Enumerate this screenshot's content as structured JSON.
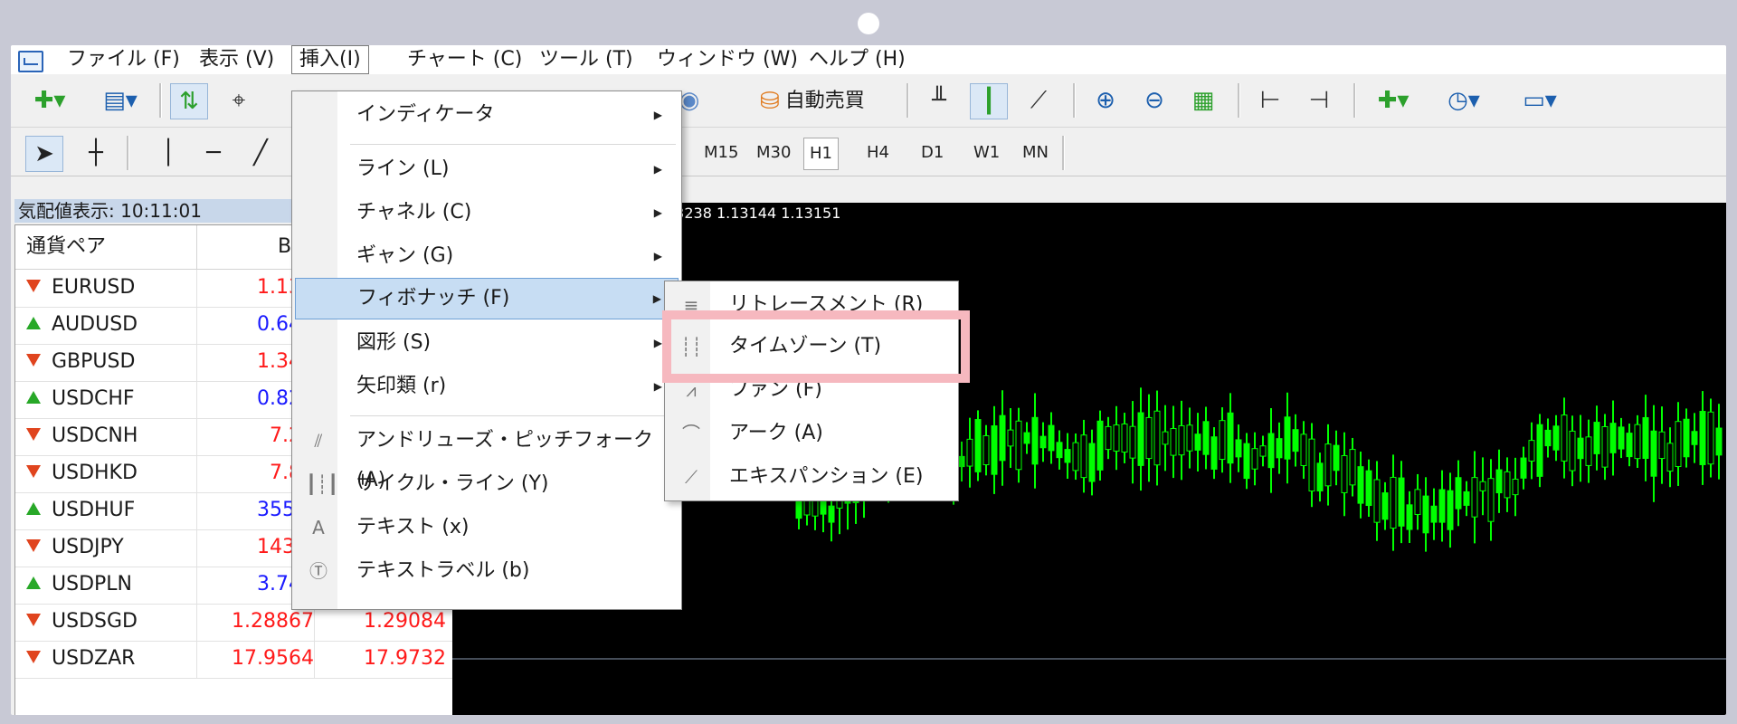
{
  "menubar": {
    "items": [
      {
        "label": "ファイル (F)"
      },
      {
        "label": "表示 (V)"
      },
      {
        "label": "挿入(I)"
      },
      {
        "label": "チャート (C)"
      },
      {
        "label": "ツール (T)"
      },
      {
        "label": "ウィンドウ (W)"
      },
      {
        "label": "ヘルプ (H)"
      }
    ]
  },
  "toolbar": {
    "autotrade_label": "自動売買"
  },
  "timeframes": [
    "M15",
    "M30",
    "H1",
    "H4",
    "D1",
    "W1",
    "MN"
  ],
  "selected_timeframe": "H1",
  "market_watch": {
    "title": "気配値表示: 10:11:01",
    "col_symbol": "通貨ペア",
    "col_bid": "B",
    "rows": [
      {
        "symbol": "EURUSD",
        "dir": "down",
        "bid": "1.131",
        "ask": ""
      },
      {
        "symbol": "AUDUSD",
        "dir": "up",
        "bid": "0.643",
        "ask": ""
      },
      {
        "symbol": "GBPUSD",
        "dir": "down",
        "bid": "1.341",
        "ask": ""
      },
      {
        "symbol": "USDCHF",
        "dir": "up",
        "bid": "0.825",
        "ask": ""
      },
      {
        "symbol": "USDCNH",
        "dir": "down",
        "bid": "7.20",
        "ask": ""
      },
      {
        "symbol": "USDHKD",
        "dir": "down",
        "bid": "7.82",
        "ask": ""
      },
      {
        "symbol": "USDHUF",
        "dir": "up",
        "bid": "355.6",
        "ask": ""
      },
      {
        "symbol": "USDJPY",
        "dir": "down",
        "bid": "143.3",
        "ask": ""
      },
      {
        "symbol": "USDPLN",
        "dir": "up",
        "bid": "3.746",
        "ask": ""
      },
      {
        "symbol": "USDSGD",
        "dir": "down",
        "bid": "1.28867",
        "ask": "1.29084"
      },
      {
        "symbol": "USDZAR",
        "dir": "down",
        "bid": "17.9564",
        "ask": "17.9732"
      }
    ]
  },
  "chart": {
    "ohlc_text": "13238 1.13144 1.13151"
  },
  "insert_menu": {
    "items": [
      {
        "label": "インディケータ",
        "sub": true
      },
      {
        "label": "ライン (L)",
        "sub": true
      },
      {
        "label": "チャネル (C)",
        "sub": true
      },
      {
        "label": "ギャン (G)",
        "sub": true
      },
      {
        "label": "フィボナッチ (F)",
        "sub": true
      },
      {
        "label": "図形 (S)",
        "sub": true
      },
      {
        "label": "矢印類 (r)",
        "sub": true
      },
      {
        "label": "アンドリューズ・ピッチフォーク (A)",
        "icon": "pitchfork-icon"
      },
      {
        "label": "サイクル・ライン (Y)",
        "icon": "cycle-lines-icon"
      },
      {
        "label": "テキスト (x)",
        "icon": "text-icon"
      },
      {
        "label": "テキストラベル (b)",
        "icon": "text-label-icon"
      }
    ]
  },
  "fib_menu": {
    "items": [
      {
        "label": "リトレースメント (R)"
      },
      {
        "label": "タイムゾーン (T)"
      },
      {
        "label": "ファン (F)"
      },
      {
        "label": "アーク (A)"
      },
      {
        "label": "エキスパンション (E)"
      }
    ]
  },
  "colors": {
    "highlight": "#f6b8bf",
    "candle": "#00ff00",
    "chart_bg": "#000000",
    "menu_hover": "#c7ddf3"
  }
}
